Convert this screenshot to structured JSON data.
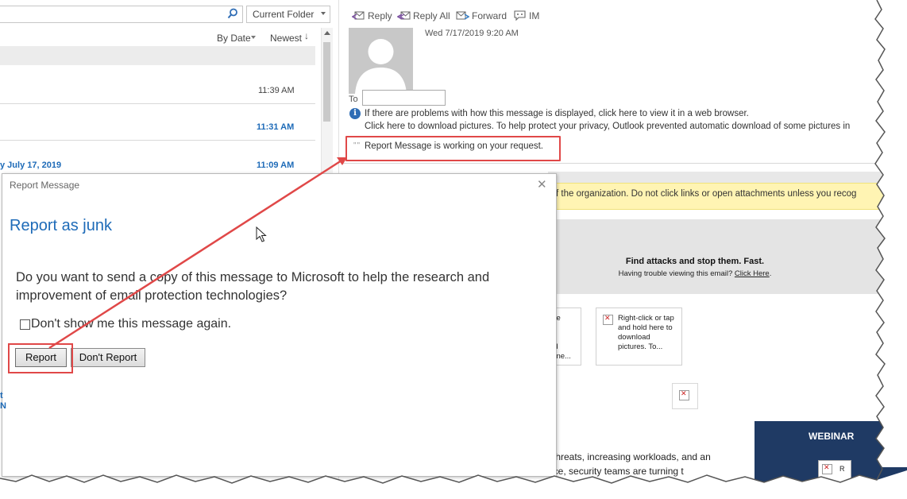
{
  "search": {
    "scope": "Current Folder"
  },
  "list": {
    "sort_by": "By Date",
    "sort_order": "Newest",
    "sort_arrow": "↓",
    "times": [
      "11:39 AM",
      "11:31 AM",
      "11:09 AM"
    ],
    "date_header": "y July 17, 2019"
  },
  "toolbar": {
    "reply": "Reply",
    "reply_all": "Reply All",
    "forward": "Forward",
    "im": "IM"
  },
  "message": {
    "date": "Wed 7/17/2019 9:20 AM",
    "to_label": "To",
    "info_line1": "If there are problems with how this message is displayed, click here to view it in a web browser.",
    "info_line2": "Click here to download pictures. To help protect your privacy, Outlook prevented automatic download of some pictures in",
    "status_dots": "\"\"",
    "status": "Report Message is working on your request.",
    "warning": "f the organization. Do not click links or open attachments unless you recog",
    "attack_title": "Find attacks and stop them. Fast.",
    "attack_sub": "Having trouble viewing this email?",
    "attack_link": "Click Here",
    "img1_text": "ere\np\nk\nad\nerne...",
    "img2_text": "Right-click or tap and hold here to download pictures. To...",
    "webinar": "WEBINAR",
    "webinar_img_text": "R",
    "body_line1": "l threats, increasing workloads, and an",
    "body_line2": "ace, security teams are turning t"
  },
  "dialog": {
    "title": "Report Message",
    "close": "✕",
    "heading": "Report as junk",
    "question": "Do you want to send a copy of this message to Microsoft to help the research and improvement of email protection technologies?",
    "checkbox_label": "Don't show me this message again.",
    "report_button": "Report",
    "dont_report_button": "Don't Report"
  },
  "colors": {
    "accent_blue": "#1e6bb8",
    "highlight_red": "#e04848",
    "warning_yellow": "#fff4b3",
    "webinar_navy": "#1f3a64"
  }
}
